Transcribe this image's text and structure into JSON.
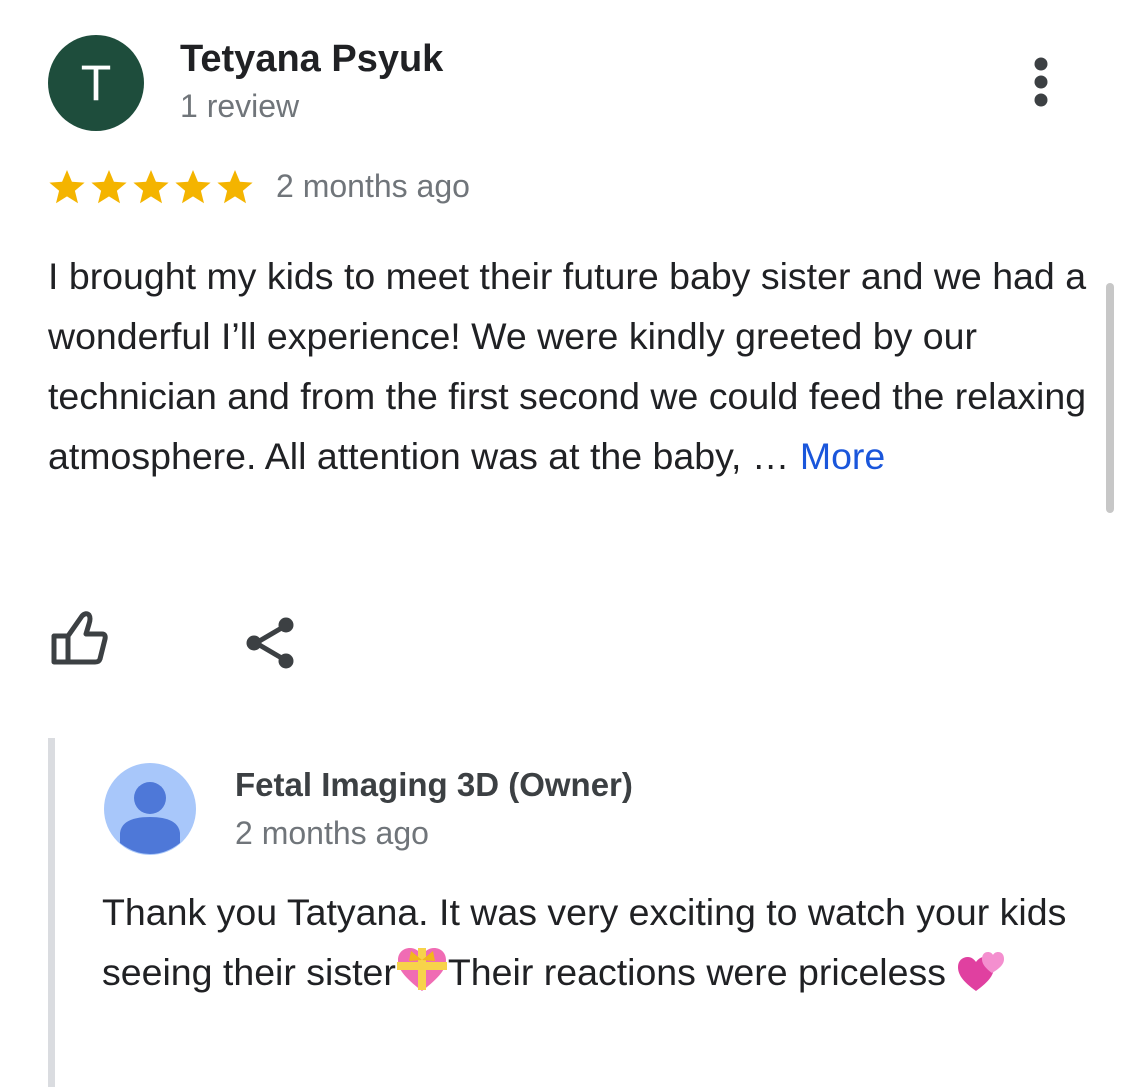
{
  "review": {
    "avatar_letter": "T",
    "avatar_color": "#1e4d3c",
    "author": "Tetyana Psyuk",
    "review_count": "1 review",
    "rating": 5,
    "rating_max": 5,
    "star_color": "#f4b400",
    "time": "2 months ago",
    "text": "I brought my kids to meet their future baby sister and we had a wonderful I’ll experience! We were kindly greeted by our technician and from the first second we could feed the relaxing atmosphere. All attention was at the baby, … ",
    "more_label": "More",
    "link_color": "#1a56db",
    "icons": {
      "menu": "more-vert-icon",
      "like": "thumbs-up-icon",
      "share": "share-icon"
    }
  },
  "owner_reply": {
    "author": "Fetal Imaging 3D (Owner)",
    "time": "2 months ago",
    "text_part1": "Thank you Tatyana. It was very exciting to watch your kids seeing their sister",
    "emoji1": "heart-with-ribbon-icon",
    "text_part2": "Their reactions were priceless ",
    "emoji2": "two-hearts-icon",
    "avatar_icon": "default-person-avatar-icon"
  }
}
